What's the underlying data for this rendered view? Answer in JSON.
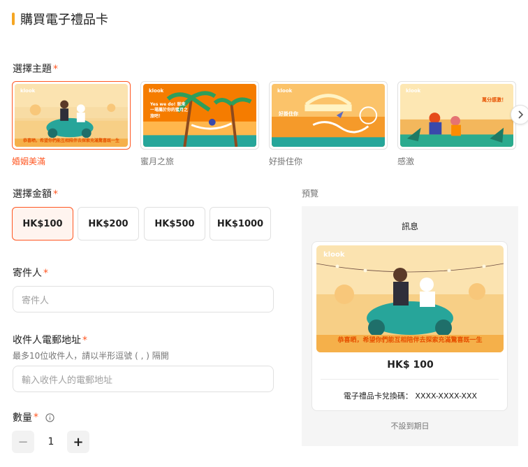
{
  "page": {
    "title": "購買電子禮品卡"
  },
  "theme_section": {
    "label": "選擇主題",
    "required_mark": "*",
    "themes": [
      {
        "name": "婚姻美滿",
        "selected": true,
        "caption": "恭喜晒，希望你們能互相陪伴去探索充滿驚喜既一生"
      },
      {
        "name": "蜜月之旅",
        "selected": false,
        "caption": "Yes we do! 就來一場屬於你的蜜月之旅吧！"
      },
      {
        "name": "好掛住你",
        "selected": false,
        "caption": "好掛住你"
      },
      {
        "name": "感激",
        "selected": false,
        "caption": "萬分感激！"
      }
    ],
    "brand": "klook"
  },
  "amount_section": {
    "label": "選擇金額",
    "required_mark": "*",
    "options": [
      "HK$100",
      "HK$200",
      "HK$500",
      "HK$1000"
    ],
    "selected": "HK$100"
  },
  "sender": {
    "label": "寄件人",
    "required_mark": "*",
    "placeholder": "寄件人"
  },
  "recipient": {
    "label": "收件人電郵地址",
    "required_mark": "*",
    "hint": "最多10位收件人，請以半形逗號 ( , ) 隔開",
    "placeholder": "輸入收件人的電郵地址"
  },
  "quantity": {
    "label": "數量",
    "required_mark": "*",
    "value": "1",
    "minus": "−",
    "plus": "+"
  },
  "preview": {
    "label": "預覽",
    "message_label": "訊息",
    "amount": "HK$ 100",
    "redeem_code": "電子禮品卡兌換碼： XXXX-XXXX-XXX",
    "expiry": "不設到期日",
    "caption": "恭喜晒，希望你們能互相陪伴去探索充滿驚喜既一生"
  },
  "colors": {
    "accent": "#ff5722",
    "title_bar": "#f5a623",
    "panel_bg": "#f5f5f5"
  }
}
